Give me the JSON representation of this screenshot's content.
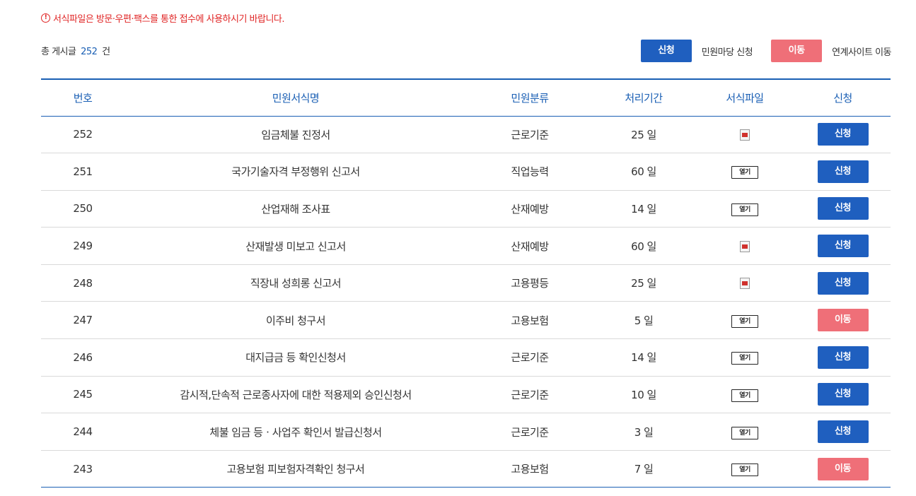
{
  "notice": {
    "icon": "info-circle-icon",
    "text": "서식파일은 방문·우편·팩스를 통한 접수에 사용하시기 바랍니다."
  },
  "summary": {
    "prefix": "총 게시글",
    "count": "252",
    "suffix": "건"
  },
  "legend": {
    "apply_label": "신청",
    "apply_desc": "민원마당 신청",
    "move_label": "이동",
    "move_desc": "연계사이트 이동"
  },
  "colors": {
    "apply": "#1f5fbf",
    "move": "#ef6f78",
    "header": "#1a5fb4",
    "notice": "#e02424"
  },
  "table": {
    "headers": [
      "번호",
      "민원서식명",
      "민원분류",
      "처리기간",
      "서식파일",
      "신청"
    ],
    "rows": [
      {
        "no": "252",
        "name": "임금체불 진정서",
        "category": "근로기준",
        "period": "25 일",
        "file": "icon",
        "action": "신청"
      },
      {
        "no": "251",
        "name": "국가기술자격 부정행위 신고서",
        "category": "직업능력",
        "period": "60 일",
        "file": "열기",
        "action": "신청"
      },
      {
        "no": "250",
        "name": "산업재해 조사표",
        "category": "산재예방",
        "period": "14 일",
        "file": "열기",
        "action": "신청"
      },
      {
        "no": "249",
        "name": "산재발생 미보고 신고서",
        "category": "산재예방",
        "period": "60 일",
        "file": "icon",
        "action": "신청"
      },
      {
        "no": "248",
        "name": "직장내 성희롱 신고서",
        "category": "고용평등",
        "period": "25 일",
        "file": "icon",
        "action": "신청"
      },
      {
        "no": "247",
        "name": "이주비 청구서",
        "category": "고용보험",
        "period": "5 일",
        "file": "열기",
        "action": "이동"
      },
      {
        "no": "246",
        "name": "대지급금 등 확인신청서",
        "category": "근로기준",
        "period": "14 일",
        "file": "열기",
        "action": "신청"
      },
      {
        "no": "245",
        "name": "감시적,단속적 근로종사자에 대한 적용제외 승인신청서",
        "category": "근로기준",
        "period": "10 일",
        "file": "열기",
        "action": "신청"
      },
      {
        "no": "244",
        "name": "체불 임금 등ㆍ사업주 확인서 발급신청서",
        "category": "근로기준",
        "period": "3 일",
        "file": "열기",
        "action": "신청"
      },
      {
        "no": "243",
        "name": "고용보험 피보험자격확인 청구서",
        "category": "고용보험",
        "period": "7 일",
        "file": "열기",
        "action": "이동"
      }
    ]
  }
}
